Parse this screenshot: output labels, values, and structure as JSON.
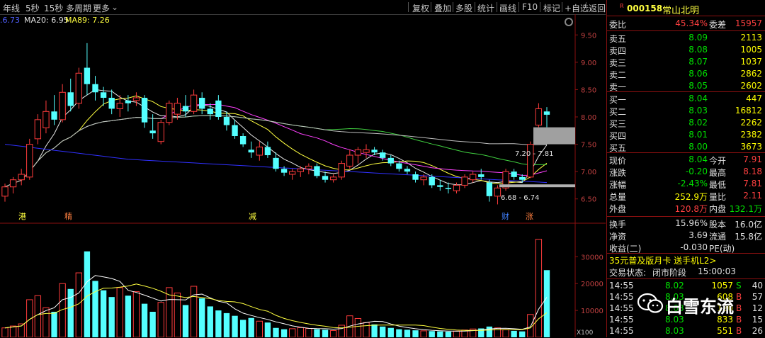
{
  "toolbar": {
    "left": [
      "年线",
      "5秒",
      "15秒",
      "多周期",
      "更多",
      "⌄"
    ],
    "right": [
      "复权",
      "叠加",
      "多股",
      "统计",
      "画线",
      "F10",
      "标记",
      "+自选",
      "返回"
    ]
  },
  "ma": {
    "ma5": ".6.73",
    "ma20": "MA20: 6.95",
    "ma89": "MA89: 7.26"
  },
  "price_ticks": [
    "9.50",
    "9.00",
    "8.50",
    "8.00",
    "7.50",
    "7.00",
    "6.50"
  ],
  "volume_ticks": [
    "30000",
    "20000",
    "10000"
  ],
  "volume_unit": "X100",
  "annotations": {
    "range_upper": "7.20 - 7.81",
    "range_lower": "6.68 - 6.74",
    "markers": [
      "港",
      "精",
      "减",
      "财",
      "涨"
    ]
  },
  "stock": {
    "code_prefix": "R",
    "code": "000158",
    "name": "常山北明",
    "webi_label": "委比",
    "webi": "45.34%",
    "weicha_label": "委差",
    "weicha": "15957"
  },
  "asks": [
    {
      "label": "卖五",
      "price": "8.09",
      "vol": "2113"
    },
    {
      "label": "卖四",
      "price": "8.08",
      "vol": "1005"
    },
    {
      "label": "卖三",
      "price": "8.07",
      "vol": "1037"
    },
    {
      "label": "卖二",
      "price": "8.06",
      "vol": "2862"
    },
    {
      "label": "卖一",
      "price": "8.05",
      "vol": "2602"
    }
  ],
  "bids": [
    {
      "label": "买一",
      "price": "8.04",
      "vol": "447"
    },
    {
      "label": "买二",
      "price": "8.03",
      "vol": "16812"
    },
    {
      "label": "买三",
      "price": "8.02",
      "vol": "2262"
    },
    {
      "label": "买四",
      "price": "8.01",
      "vol": "2382"
    },
    {
      "label": "买五",
      "price": "8.00",
      "vol": "3673"
    }
  ],
  "quote": [
    {
      "l1": "现价",
      "v1": "8.04",
      "c1": "green",
      "l2": "今开",
      "v2": "7.91",
      "c2": "red"
    },
    {
      "l1": "涨跌",
      "v1": "-0.20",
      "c1": "green",
      "l2": "最高",
      "v2": "8.18",
      "c2": "red"
    },
    {
      "l1": "涨幅",
      "v1": "-2.43%",
      "c1": "green",
      "l2": "最低",
      "v2": "7.81",
      "c2": "red"
    },
    {
      "l1": "总量",
      "v1": "252.9万",
      "c1": "yellow",
      "l2": "量比",
      "v2": "2.11",
      "c2": "red"
    },
    {
      "l1": "外盘",
      "v1": "120.8万",
      "c1": "red",
      "l2": "内盘",
      "v2": "132.1万",
      "c2": "green"
    }
  ],
  "stats": [
    {
      "l1": "换手",
      "v1": "15.96%",
      "l2": "股本",
      "v2": "16.0亿"
    },
    {
      "l1": "净资",
      "v1": "3.69",
      "l2": "流通",
      "v2": "15.8亿"
    },
    {
      "l1": "收益(二)",
      "v1": "-0.030",
      "l2": "PE(动)",
      "v2": ""
    }
  ],
  "promo": "35元普及版月卡 送手机L2>",
  "trade_status": {
    "label": "交易状态:",
    "state": "闭市阶段",
    "time": "15:00:03"
  },
  "ticks": [
    {
      "time": "14:55",
      "price": "8.02",
      "vol": "1057",
      "side": "S",
      "n": "40"
    },
    {
      "time": "14:55",
      "price": "8.03",
      "vol": "608",
      "side": "B",
      "n": "57"
    },
    {
      "time": "14:55",
      "price": "8.03",
      "vol": "120",
      "side": "B",
      "n": "12"
    },
    {
      "time": "14:55",
      "price": "8.03",
      "vol": "833",
      "side": "B",
      "n": "15"
    },
    {
      "time": "14:55",
      "price": "8.03",
      "vol": "551",
      "side": "B",
      "n": "26"
    }
  ],
  "watermark": "白雪东流",
  "chart_data": {
    "type": "candlestick",
    "price_range": [
      6.25,
      9.75
    ],
    "volume_range": [
      0,
      38000
    ],
    "candles": [
      [
        6.55,
        6.78,
        6.45,
        6.72
      ],
      [
        6.72,
        6.9,
        6.6,
        6.85
      ],
      [
        6.85,
        7.05,
        6.75,
        6.95
      ],
      [
        6.9,
        7.6,
        6.85,
        7.5
      ],
      [
        7.6,
        8.05,
        7.5,
        7.95
      ],
      [
        7.8,
        8.3,
        7.7,
        8.1
      ],
      [
        8.1,
        8.4,
        7.85,
        7.95
      ],
      [
        7.95,
        8.6,
        7.9,
        8.45
      ],
      [
        8.45,
        8.7,
        8.1,
        8.2
      ],
      [
        8.25,
        8.9,
        8.15,
        8.8
      ],
      [
        8.9,
        9.35,
        8.4,
        8.6
      ],
      [
        8.6,
        8.75,
        8.3,
        8.45
      ],
      [
        8.45,
        8.55,
        8.2,
        8.35
      ],
      [
        8.35,
        8.5,
        8.05,
        8.15
      ],
      [
        8.15,
        8.4,
        8.0,
        8.25
      ],
      [
        8.3,
        8.4,
        8.1,
        8.25
      ],
      [
        8.3,
        8.45,
        8.2,
        8.35
      ],
      [
        8.35,
        8.4,
        7.8,
        7.9
      ],
      [
        7.75,
        8.05,
        7.6,
        7.7
      ],
      [
        7.55,
        7.95,
        7.5,
        7.9
      ],
      [
        7.9,
        8.3,
        7.85,
        8.25
      ],
      [
        8.05,
        8.35,
        7.95,
        8.25
      ],
      [
        8.2,
        8.4,
        8.0,
        8.1
      ],
      [
        8.1,
        8.5,
        8.05,
        8.4
      ],
      [
        8.35,
        8.45,
        8.05,
        8.15
      ],
      [
        8.15,
        8.25,
        7.95,
        8.05
      ],
      [
        8.3,
        8.4,
        7.95,
        8.0
      ],
      [
        8.0,
        8.1,
        7.75,
        7.85
      ],
      [
        7.85,
        7.95,
        7.6,
        7.65
      ],
      [
        7.65,
        7.7,
        7.45,
        7.5
      ],
      [
        7.4,
        7.55,
        7.25,
        7.35
      ],
      [
        7.3,
        7.55,
        7.2,
        7.45
      ],
      [
        7.45,
        7.55,
        7.25,
        7.3
      ],
      [
        7.25,
        7.35,
        7.0,
        7.05
      ],
      [
        7.05,
        7.1,
        6.92,
        6.98
      ],
      [
        6.95,
        7.05,
        6.85,
        7.0
      ],
      [
        7.0,
        7.1,
        6.9,
        7.05
      ],
      [
        7.05,
        7.15,
        6.95,
        7.1
      ],
      [
        7.1,
        7.15,
        6.88,
        6.92
      ],
      [
        6.92,
        7.0,
        6.8,
        6.85
      ],
      [
        6.85,
        6.95,
        6.8,
        6.9
      ],
      [
        6.9,
        7.2,
        6.85,
        7.15
      ],
      [
        7.1,
        7.4,
        7.05,
        7.3
      ],
      [
        7.3,
        7.45,
        7.15,
        7.4
      ],
      [
        7.35,
        7.5,
        7.25,
        7.4
      ],
      [
        7.4,
        7.45,
        7.3,
        7.35
      ],
      [
        7.35,
        7.4,
        7.2,
        7.25
      ],
      [
        7.25,
        7.3,
        7.1,
        7.15
      ],
      [
        7.15,
        7.2,
        7.0,
        7.05
      ],
      [
        7.05,
        7.1,
        6.95,
        7.0
      ],
      [
        6.95,
        7.0,
        6.8,
        6.85
      ],
      [
        6.85,
        6.95,
        6.75,
        6.9
      ],
      [
        6.9,
        6.95,
        6.7,
        6.75
      ],
      [
        6.75,
        6.85,
        6.65,
        6.72
      ],
      [
        6.7,
        6.8,
        6.6,
        6.68
      ],
      [
        6.65,
        6.8,
        6.6,
        6.75
      ],
      [
        6.75,
        6.95,
        6.7,
        6.9
      ],
      [
        6.85,
        7.0,
        6.8,
        6.95
      ],
      [
        6.95,
        7.05,
        6.85,
        6.9
      ],
      [
        6.8,
        6.85,
        6.45,
        6.55
      ],
      [
        6.55,
        6.75,
        6.4,
        6.7
      ],
      [
        6.7,
        7.05,
        6.65,
        7.0
      ],
      [
        7.0,
        7.05,
        6.85,
        6.9
      ],
      [
        6.9,
        6.95,
        6.8,
        6.85
      ],
      [
        6.9,
        7.55,
        6.88,
        7.5
      ],
      [
        7.85,
        8.25,
        7.81,
        8.15
      ],
      [
        8.1,
        8.18,
        7.81,
        8.04
      ]
    ],
    "volumes": [
      3500,
      4200,
      5000,
      14000,
      15500,
      11000,
      9500,
      20000,
      18000,
      24000,
      32000,
      21000,
      17500,
      15000,
      18500,
      15500,
      17000,
      12500,
      9500,
      13000,
      18500,
      16500,
      12000,
      19000,
      14500,
      11500,
      10000,
      9000,
      8000,
      6500,
      7200,
      6000,
      5500,
      3500,
      3000,
      3200,
      3600,
      3300,
      3000,
      2800,
      2500,
      4500,
      8000,
      7000,
      5500,
      4800,
      4000,
      3500,
      3000,
      2800,
      2600,
      2400,
      2300,
      2200,
      2100,
      2300,
      2700,
      3100,
      3300,
      4000,
      3500,
      2800,
      2400,
      2200,
      8500,
      36500,
      25000
    ]
  }
}
